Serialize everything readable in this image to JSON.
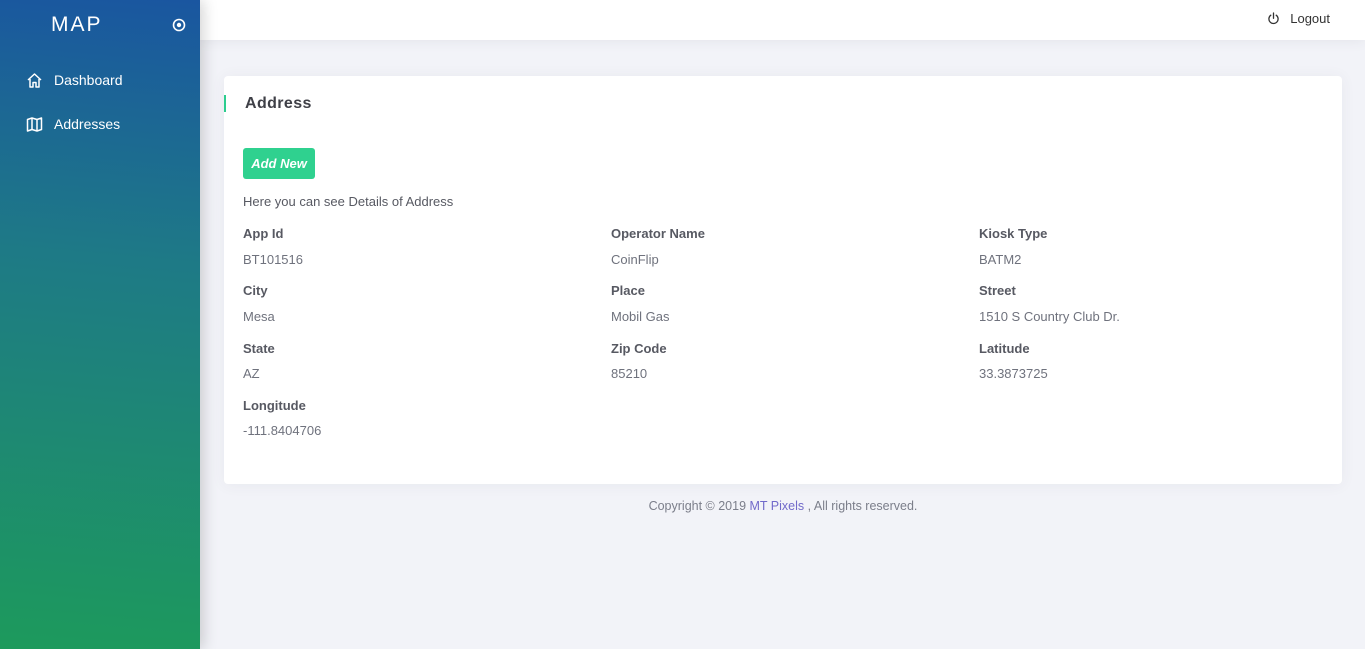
{
  "sidebar": {
    "brand": "MAP",
    "items": [
      {
        "label": "Dashboard",
        "icon": "home-icon"
      },
      {
        "label": "Addresses",
        "icon": "map-icon"
      }
    ]
  },
  "topbar": {
    "logout_label": "Logout"
  },
  "card": {
    "title": "Address",
    "add_button_label": "Add New",
    "intro": "Here you can see Details of Address",
    "fields": [
      {
        "label": "App Id",
        "value": "BT101516"
      },
      {
        "label": "Operator Name",
        "value": "CoinFlip"
      },
      {
        "label": "Kiosk Type",
        "value": "BATM2"
      },
      {
        "label": "City",
        "value": "Mesa"
      },
      {
        "label": "Place",
        "value": "Mobil Gas"
      },
      {
        "label": "Street",
        "value": "1510 S Country Club Dr."
      },
      {
        "label": "State",
        "value": "AZ"
      },
      {
        "label": "Zip Code",
        "value": "85210"
      },
      {
        "label": "Latitude",
        "value": "33.3873725"
      },
      {
        "label": "Longitude",
        "value": "-111.8404706"
      }
    ]
  },
  "footer": {
    "prefix": "Copyright © 2019 ",
    "link": "MT Pixels",
    "suffix": " , All rights reserved."
  },
  "colors": {
    "accent": "#2fd18f",
    "link": "#716aca"
  }
}
